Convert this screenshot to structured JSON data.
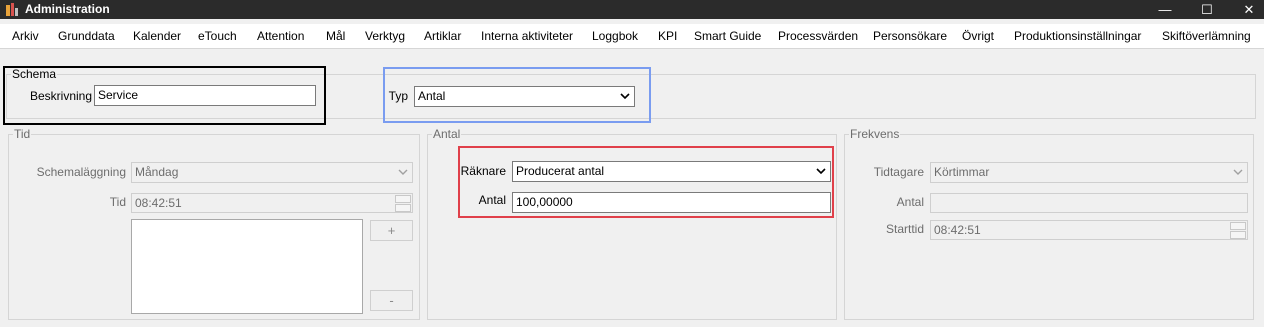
{
  "window": {
    "title": "Administration",
    "minimize_glyph": "—",
    "maximize_glyph": "☐",
    "close_glyph": "✕"
  },
  "menu": {
    "items": [
      "Arkiv",
      "Grunddata",
      "Kalender",
      "eTouch",
      "Attention",
      "Mål",
      "Verktyg",
      "Artiklar",
      "Interna aktiviteter",
      "Loggbok",
      "KPI",
      "Smart Guide",
      "Processvärden",
      "Personsökare",
      "Övrigt",
      "Produktionsinställningar",
      "Skiftöverlämning"
    ]
  },
  "schema": {
    "legend": "Schema",
    "beskrivning_label": "Beskrivning",
    "beskrivning_value": "Service",
    "typ_label": "Typ",
    "typ_value": "Antal"
  },
  "tid": {
    "legend": "Tid",
    "schemalaggning_label": "Schemaläggning",
    "schemalaggning_value": "Måndag",
    "tid_label": "Tid",
    "tid_value": "08:42:51",
    "add_button": "+",
    "remove_button": "-"
  },
  "antal": {
    "legend": "Antal",
    "raknare_label": "Räknare",
    "raknare_value": "Producerat antal",
    "antal_label": "Antal",
    "antal_value": "100,00000"
  },
  "frekvens": {
    "legend": "Frekvens",
    "tidtagare_label": "Tidtagare",
    "tidtagare_value": "Körtimmar",
    "antal_label": "Antal",
    "antal_value": "",
    "starttid_label": "Starttid",
    "starttid_value": "08:42:51"
  },
  "colors": {
    "titlebar": "#2b2b2b",
    "highlight_black": "#000000",
    "highlight_blue": "#7a9cf0",
    "highlight_red": "#e0404a"
  }
}
